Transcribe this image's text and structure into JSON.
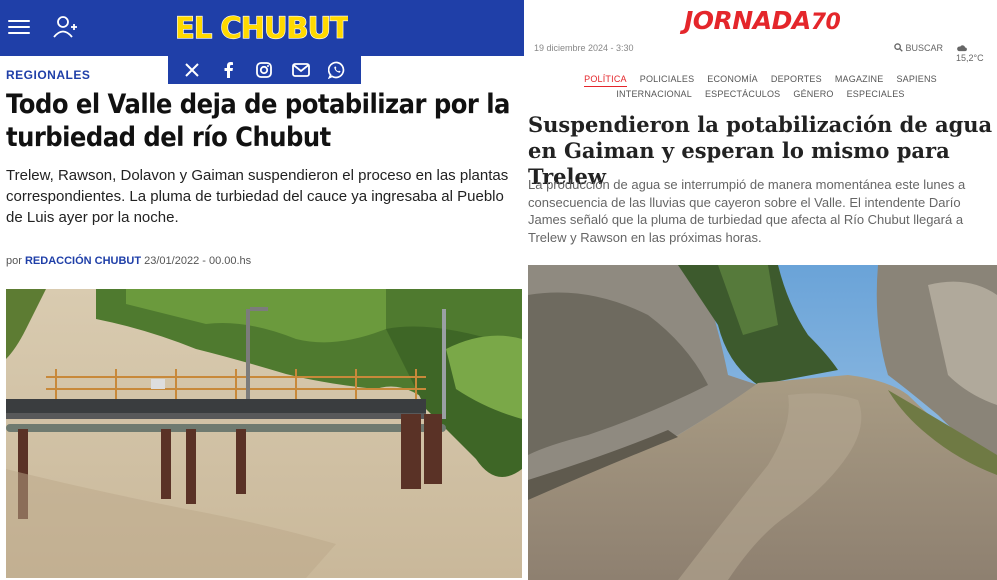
{
  "left": {
    "logo_text": "EL CHUBUT",
    "section": "REGIONALES",
    "title": "Todo el Valle deja de potabilizar por la turbiedad del río Chubut",
    "summary": "Trelew, Rawson, Dolavon y Gaiman suspendieron el proceso en las plantas correspondientes.  La pluma de turbiedad del cauce ya ingresaba al Pueblo de Luis ayer por la noche.",
    "byline_prefix": "por",
    "author": "REDACCIÓN CHUBUT",
    "date": "23/01/2022 - 00.00.hs",
    "social": [
      {
        "name": "x-icon",
        "glyph": "𝕏"
      },
      {
        "name": "facebook-icon",
        "glyph": "f"
      },
      {
        "name": "instagram-icon",
        "glyph": "◎"
      },
      {
        "name": "mail-icon",
        "glyph": "✉"
      },
      {
        "name": "whatsapp-icon",
        "glyph": "✆"
      }
    ],
    "colors": {
      "brand": "#1f3fa8",
      "logo_fill": "#ffd900"
    }
  },
  "right": {
    "logo_text": "JORNADA",
    "logo_number": "70",
    "date": "19 diciembre 2024 - 3:30",
    "search_label": "BUSCAR",
    "weather": "15,2°C",
    "nav_row1": [
      "POLÍTICA",
      "POLICIALES",
      "ECONOMÍA",
      "DEPORTES",
      "MAGAZINE",
      "SAPIENS"
    ],
    "nav_row2": [
      "INTERNACIONAL",
      "ESPECTÁCULOS",
      "GÉNERO",
      "ESPECIALES"
    ],
    "title": "Suspendieron la potabilización de agua en Gaiman y esperan lo mismo para Trelew",
    "summary": "La producción de agua se interrumpió de manera momentánea este lunes a consecuencia de las lluvias que cayeron sobre el Valle. El intendente Darío James señaló que la pluma de turbiedad que afecta al Río Chubut llegará a Trelew y Rawson en las próximas horas.",
    "colors": {
      "brand": "#e4262b"
    }
  }
}
